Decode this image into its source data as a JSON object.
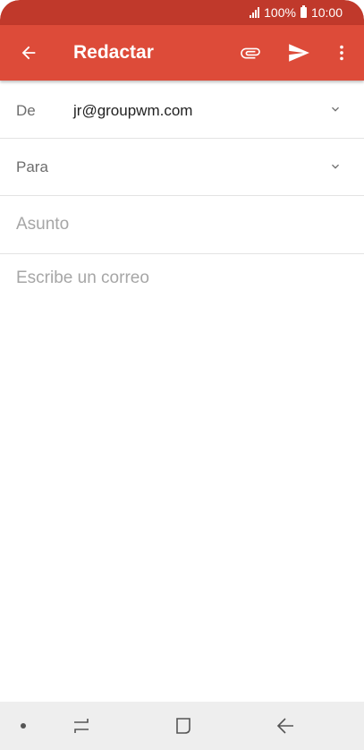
{
  "status_bar": {
    "battery": "100%",
    "time": "10:00"
  },
  "toolbar": {
    "title": "Redactar",
    "icons": {
      "back": "arrow-back-icon",
      "attach": "paperclip-icon",
      "send": "send-icon",
      "more": "more-vert-icon"
    },
    "color": "#dd4b39"
  },
  "form": {
    "from_label": "De",
    "from_value": "jr@groupwm.com",
    "to_label": "Para",
    "subject_placeholder": "Asunto",
    "body_placeholder": "Escribe un correo"
  },
  "nav_bar": {
    "icons": [
      "dot-icon",
      "recent-apps-icon",
      "home-icon",
      "nav-back-icon"
    ]
  }
}
